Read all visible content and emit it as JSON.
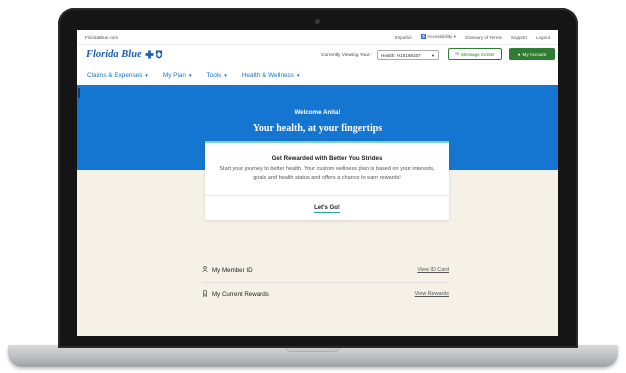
{
  "utility": {
    "site": "FloridaBlue.com",
    "links": [
      "Español",
      "Accessibility",
      "Glossary of Terms",
      "Support",
      "Logout"
    ]
  },
  "brand": {
    "logo_text": "Florida Blue",
    "viewing_label": "Currently Viewing Your:",
    "plan_selected": "Health: H16168167",
    "message_center": "Message Center",
    "my_account": "My Account"
  },
  "nav": {
    "items": [
      "Claims & Expenses",
      "My Plan",
      "Tools",
      "Health & Wellness"
    ]
  },
  "hero": {
    "welcome": "Welcome Anita!",
    "tagline": "Your health, at your fingertips"
  },
  "card": {
    "title": "Get Rewarded with Better You Strides",
    "body": "Start your journey to better health. Your custom wellness plan is based on your interests, goals and health status and offers a chance to earn rewards!",
    "cta": "Let's Go!"
  },
  "rows": [
    {
      "label": "My Member ID",
      "link": "View ID Card"
    },
    {
      "label": "My Current Rewards",
      "link": "View Rewards"
    }
  ],
  "colors": {
    "brand_blue": "#1576d1",
    "accent_green": "#2e7d32",
    "cream": "#f6f1e6"
  }
}
